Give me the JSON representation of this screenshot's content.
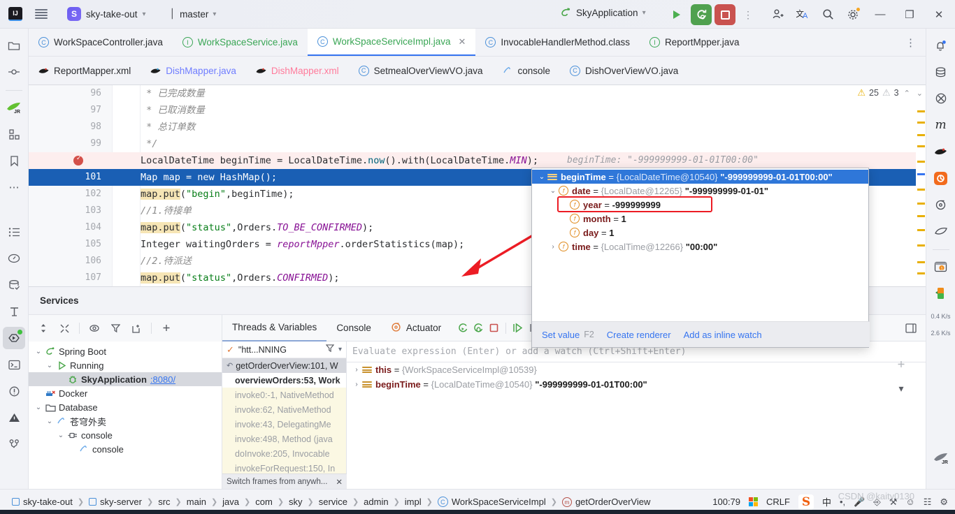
{
  "titlebar": {
    "logo": "IJ",
    "menu_icon": "hamburger-icon",
    "project_initial": "S",
    "project_name": "sky-take-out",
    "branch_icon": "branch-icon",
    "branch_name": "master",
    "run_config": "SkyApplication",
    "run_icon": "run-icon",
    "debug_icon": "debug-icon",
    "stop_icon": "stop-icon",
    "more_icon": "more-vertical-icon",
    "account_icon": "add-user-icon",
    "translate_icon": "translate-icon",
    "search_icon": "search-icon",
    "settings_icon": "gear-icon",
    "minimize": "—",
    "maximize": "❐",
    "close": "✕"
  },
  "left_rail": [
    {
      "name": "project-icon",
      "glyph": "▭"
    },
    {
      "name": "commit-icon",
      "glyph": "⊸"
    },
    {
      "name": "jrebel-icon",
      "glyph": "JR"
    },
    {
      "name": "structure-icon",
      "glyph": "◫"
    },
    {
      "name": "bookmarks-icon",
      "glyph": "⚑"
    },
    {
      "name": "more-tools-icon",
      "glyph": "⋯"
    },
    {
      "name": "todo-icon",
      "glyph": "☰"
    },
    {
      "name": "profiler-icon",
      "glyph": "◴"
    },
    {
      "name": "database-icon",
      "glyph": "⛁"
    },
    {
      "name": "build-icon",
      "glyph": "⚒"
    },
    {
      "name": "services-icon",
      "glyph": "▶"
    },
    {
      "name": "terminal-icon",
      "glyph": "⌨"
    },
    {
      "name": "problems-icon",
      "glyph": "ⓘ"
    },
    {
      "name": "warnings-icon",
      "glyph": "⚠"
    },
    {
      "name": "git-icon",
      "glyph": "⑂"
    }
  ],
  "right_rail": [
    {
      "name": "notifications-icon",
      "glyph": "ὑ4"
    },
    {
      "name": "database-icon",
      "glyph": "⛁"
    },
    {
      "name": "maven-icon",
      "glyph": "ⓜ"
    },
    {
      "name": "maven-m-icon",
      "glyph": "m"
    },
    {
      "name": "mybatis-icon",
      "glyph": "◕"
    },
    {
      "name": "apifox-icon",
      "glyph": "◉"
    },
    {
      "name": "gateway-icon",
      "glyph": "⊚"
    },
    {
      "name": "leaf-icon",
      "glyph": "◡"
    },
    {
      "name": "wallet-icon",
      "glyph": "▤"
    },
    {
      "name": "battery-icon",
      "glyph": "▮"
    },
    {
      "name": "network-up",
      "glyph": "0.4 K/s"
    },
    {
      "name": "network-down",
      "glyph": "2.6 K/s"
    },
    {
      "name": "jrebel-icon",
      "glyph": "JR"
    }
  ],
  "editor_tabs_row1": [
    {
      "label": "WorkSpaceController.java",
      "icon": "class-icon",
      "kind": "class",
      "active": false,
      "closable": false
    },
    {
      "label": "WorkSpaceService.java",
      "icon": "interface-icon",
      "kind": "interface",
      "active": false,
      "closable": false
    },
    {
      "label": "WorkSpaceServiceImpl.java",
      "icon": "class-icon",
      "kind": "class",
      "active": true,
      "closable": true
    },
    {
      "label": "InvocableHandlerMethod.class",
      "icon": "class-icon",
      "kind": "class",
      "active": false,
      "closable": false
    },
    {
      "label": "ReportMpper.java",
      "icon": "interface-icon",
      "kind": "interface",
      "active": false,
      "closable": false
    }
  ],
  "editor_tabs_row2": [
    {
      "label": "ReportMapper.xml",
      "icon": "mybatis-icon",
      "kind": "xml",
      "active": false
    },
    {
      "label": "DishMapper.java",
      "icon": "mybatis-icon",
      "kind": "xml-blue",
      "active": false
    },
    {
      "label": "DishMapper.xml",
      "icon": "mybatis-icon",
      "kind": "xml-pink",
      "active": false
    },
    {
      "label": "SetmealOverViewVO.java",
      "icon": "class-icon",
      "kind": "class",
      "active": false
    },
    {
      "label": "console",
      "icon": "console-icon",
      "kind": "console",
      "active": false
    },
    {
      "label": "DishOverViewVO.java",
      "icon": "class-icon",
      "kind": "class",
      "active": false
    }
  ],
  "inspection": {
    "warning_icon": "warning-triangle-icon",
    "warning_count": "25",
    "weak_icon": "weak-warning-icon",
    "weak_count": "3",
    "up": "⌃",
    "down": "⌄"
  },
  "code": {
    "lines": [
      {
        "num": "96",
        "text": " * 已完成数量",
        "style": "comment"
      },
      {
        "num": "97",
        "text": " * 已取消数量",
        "style": "comment"
      },
      {
        "num": "98",
        "text": " * 总订单数",
        "style": "comment"
      },
      {
        "num": "99",
        "text": " */",
        "style": "comment"
      },
      {
        "num": "100",
        "text": "LocalDateTime beginTime = LocalDateTime.now().with(LocalDateTime.MIN);",
        "style": "breakpoint",
        "hint": "beginTime:  \"-999999999-01-01T00:00\""
      },
      {
        "num": "101",
        "text": "Map map = new HashMap();",
        "style": "selected"
      },
      {
        "num": "102",
        "text": "map.put(\"begin\",beginTime);",
        "style": "code"
      },
      {
        "num": "103",
        "text": "//1.待接单",
        "style": "comment"
      },
      {
        "num": "104",
        "text": "map.put(\"status\",Orders.TO_BE_CONFIRMED);",
        "style": "code"
      },
      {
        "num": "105",
        "text": "Integer waitingOrders = reportMpper.orderStatistics(map);",
        "style": "code"
      },
      {
        "num": "106",
        "text": "//2.待派送",
        "style": "comment"
      },
      {
        "num": "107",
        "text": "map.put(\"status\",Orders.CONFIRMED);",
        "style": "code"
      }
    ]
  },
  "popup": {
    "rows": [
      {
        "indent": 0,
        "arrow": "⌄",
        "icon": "object-icon",
        "name": "beginTime",
        "type": "{LocalDateTime@10540}",
        "value": "\"-999999999-01-01T00:00\"",
        "selected": true
      },
      {
        "indent": 1,
        "arrow": "⌄",
        "icon": "field-icon",
        "name": "date",
        "type": "{LocalDate@12265}",
        "value": "\"-999999999-01-01\"",
        "selected": false
      },
      {
        "indent": 2,
        "arrow": "",
        "icon": "field-icon",
        "name": "year",
        "type": "",
        "value": "-999999999",
        "selected": false,
        "highlighted": true
      },
      {
        "indent": 2,
        "arrow": "",
        "icon": "field-icon",
        "name": "month",
        "type": "",
        "value": "1",
        "selected": false
      },
      {
        "indent": 2,
        "arrow": "",
        "icon": "field-icon",
        "name": "day",
        "type": "",
        "value": "1",
        "selected": false
      },
      {
        "indent": 1,
        "arrow": "›",
        "icon": "field-icon",
        "name": "time",
        "type": "{LocalTime@12266}",
        "value": "\"00:00\"",
        "selected": false
      }
    ],
    "footer": {
      "set_value": "Set value",
      "set_value_key": "F2",
      "create_renderer": "Create renderer",
      "inline_watch": "Add as inline watch"
    }
  },
  "services": {
    "title": "Services",
    "toolbar": [
      {
        "name": "expand-collapse-icon",
        "glyph": "⇅"
      },
      {
        "name": "collapse-all-icon",
        "glyph": "⤨"
      },
      {
        "name": "settings-eye-icon",
        "glyph": "◎"
      },
      {
        "name": "filter-icon",
        "glyph": "▽"
      },
      {
        "name": "new-tab-icon",
        "glyph": "⧉"
      },
      {
        "name": "add-icon",
        "glyph": "＋"
      }
    ],
    "tree": [
      {
        "indent": 0,
        "caret": "⌄",
        "icon": "spring-boot-icon",
        "label": "Spring Boot",
        "selected": false
      },
      {
        "indent": 1,
        "caret": "⌄",
        "icon": "run-icon",
        "label": "Running",
        "selected": false
      },
      {
        "indent": 2,
        "caret": "",
        "icon": "spring-bug-icon",
        "label": "SkyApplication",
        "port": ":8080/",
        "selected": true
      },
      {
        "indent": 0,
        "caret": "",
        "icon": "docker-icon",
        "label": "Docker",
        "selected": false
      },
      {
        "indent": 0,
        "caret": "⌄",
        "icon": "folder-icon",
        "label": "Database",
        "selected": false
      },
      {
        "indent": 1,
        "caret": "⌄",
        "icon": "db-console-icon",
        "label": "苍穹外卖",
        "selected": false
      },
      {
        "indent": 2,
        "caret": "⌄",
        "icon": "connection-icon",
        "label": "console",
        "selected": false
      },
      {
        "indent": 3,
        "caret": "",
        "icon": "db-console-icon",
        "label": "console",
        "selected": false
      }
    ]
  },
  "debug_tabs": {
    "tabs": [
      {
        "label": "Threads & Variables",
        "active": true,
        "icon": ""
      },
      {
        "label": "Console",
        "active": false,
        "icon": ""
      },
      {
        "label": "Actuator",
        "active": false,
        "icon": "actuator-icon"
      }
    ],
    "controls": [
      {
        "name": "rerun-icon",
        "glyph": "⟳"
      },
      {
        "name": "rerun-debug-icon",
        "glyph": "⟳"
      },
      {
        "name": "stop-icon",
        "glyph": "□"
      },
      {
        "name": "resume-icon",
        "glyph": "⏵"
      },
      {
        "name": "pause-icon",
        "glyph": "⏸"
      }
    ]
  },
  "frames": {
    "thread": "\"htt...NNING",
    "filter_icon": "filter-icon",
    "dropdown_icon": "chevron-down-icon",
    "rows": [
      {
        "label": "getOrderOverView:101, W",
        "current": true,
        "lib": false
      },
      {
        "label": "overviewOrders:53, Work",
        "current": false,
        "lib": false,
        "bold": true
      },
      {
        "label": "invoke0:-1, NativeMethod",
        "current": false,
        "lib": true
      },
      {
        "label": "invoke:62, NativeMethod",
        "current": false,
        "lib": true
      },
      {
        "label": "invoke:43, DelegatingMe",
        "current": false,
        "lib": true
      },
      {
        "label": "invoke:498, Method (java",
        "current": false,
        "lib": true
      },
      {
        "label": "doInvoke:205, Invocable",
        "current": false,
        "lib": true
      },
      {
        "label": "invokeForRequest:150, In",
        "current": false,
        "lib": true
      }
    ],
    "footer": "Switch frames from anywh...",
    "footer_close": "✕"
  },
  "variables": {
    "eval_placeholder": "Evaluate expression (Enter) or add a watch (Ctrl+Shift+Enter)",
    "rows": [
      {
        "arrow": "›",
        "icon": "object-icon",
        "name": "this",
        "type": "{WorkSpaceServiceImpl@10539}",
        "value": ""
      },
      {
        "arrow": "›",
        "icon": "object-icon",
        "name": "beginTime",
        "type": "{LocalDateTime@10540}",
        "value": "\"-999999999-01-01T00:00\""
      }
    ]
  },
  "statusbar": {
    "breadcrumbs": [
      {
        "label": "sky-take-out",
        "icon": "module-icon"
      },
      {
        "label": "sky-server",
        "icon": "module-icon"
      },
      {
        "label": "src",
        "icon": ""
      },
      {
        "label": "main",
        "icon": ""
      },
      {
        "label": "java",
        "icon": ""
      },
      {
        "label": "com",
        "icon": ""
      },
      {
        "label": "sky",
        "icon": ""
      },
      {
        "label": "service",
        "icon": ""
      },
      {
        "label": "admin",
        "icon": ""
      },
      {
        "label": "impl",
        "icon": ""
      },
      {
        "label": "WorkSpaceServiceImpl",
        "icon": "class-icon"
      },
      {
        "label": "getOrderOverView",
        "icon": "method-icon"
      }
    ],
    "caret_position": "100:79",
    "line_separator": "CRLF",
    "ime": "中",
    "watermark": "CSDN @kaity0130"
  },
  "colors": {
    "accent": "#3574f0",
    "selection": "#1a5fb4",
    "breakpoint": "#d4504a",
    "highlight_red": "#ec1c24",
    "green": "#50a14f",
    "red": "#c9524f",
    "warning": "#e8b007"
  }
}
